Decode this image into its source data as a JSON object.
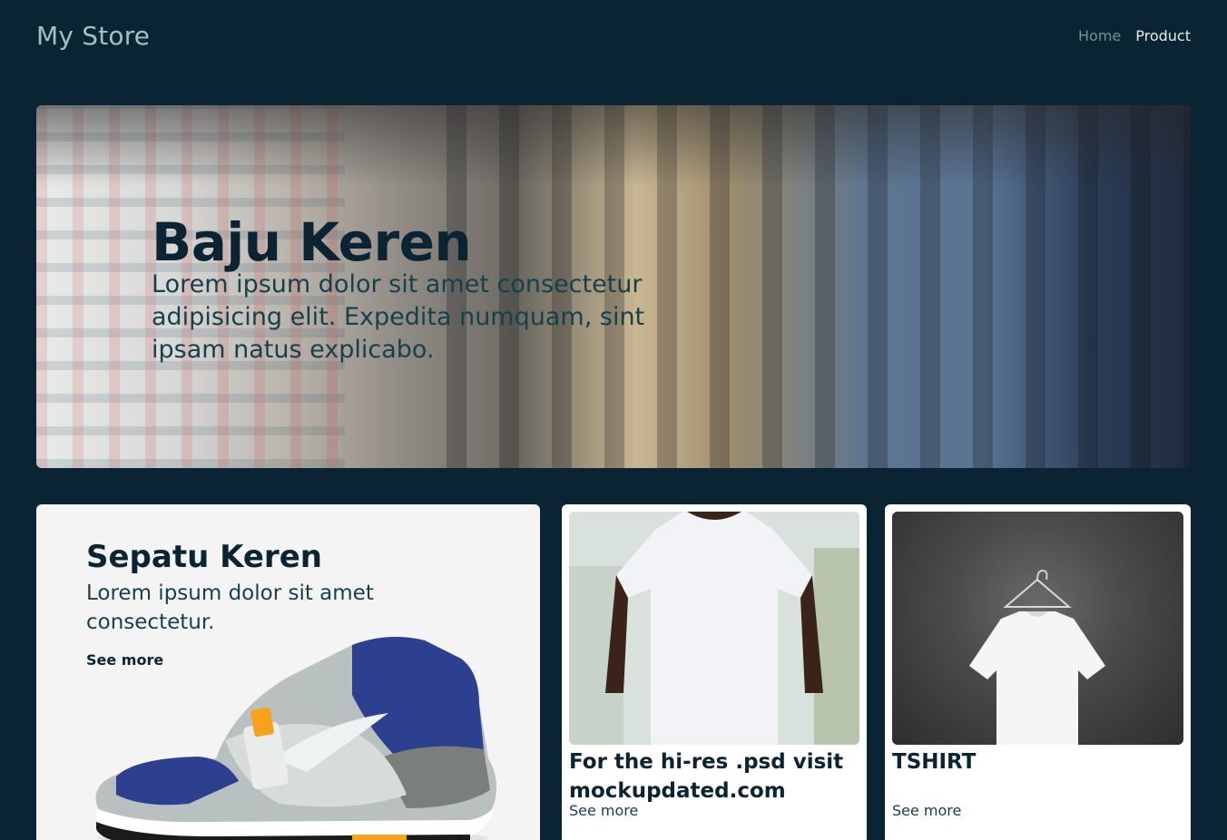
{
  "header": {
    "logo": "My Store",
    "nav": [
      {
        "label": "Home"
      },
      {
        "label": "Product"
      }
    ]
  },
  "hero": {
    "title": "Baju Keren",
    "description": "Lorem ipsum dolor sit amet consectetur adipisicing elit. Expedita numquam, sint ipsam natus explicabo."
  },
  "featured": {
    "title": "Sepatu Keren",
    "description": "Lorem ipsum dolor sit amet consectetur.",
    "see_more": "See more"
  },
  "products": [
    {
      "title": "For the hi-res .psd visit mockupdated.com",
      "see_more": "See more"
    },
    {
      "title": "TSHIRT",
      "see_more": "See more"
    }
  ],
  "colors": {
    "background": "#0a2433",
    "logo": "#9fc3bf",
    "nav_home": "#6e9793",
    "nav_product": "#e6ecec",
    "text_dark": "#0b2433",
    "text_teal": "#15414d"
  }
}
